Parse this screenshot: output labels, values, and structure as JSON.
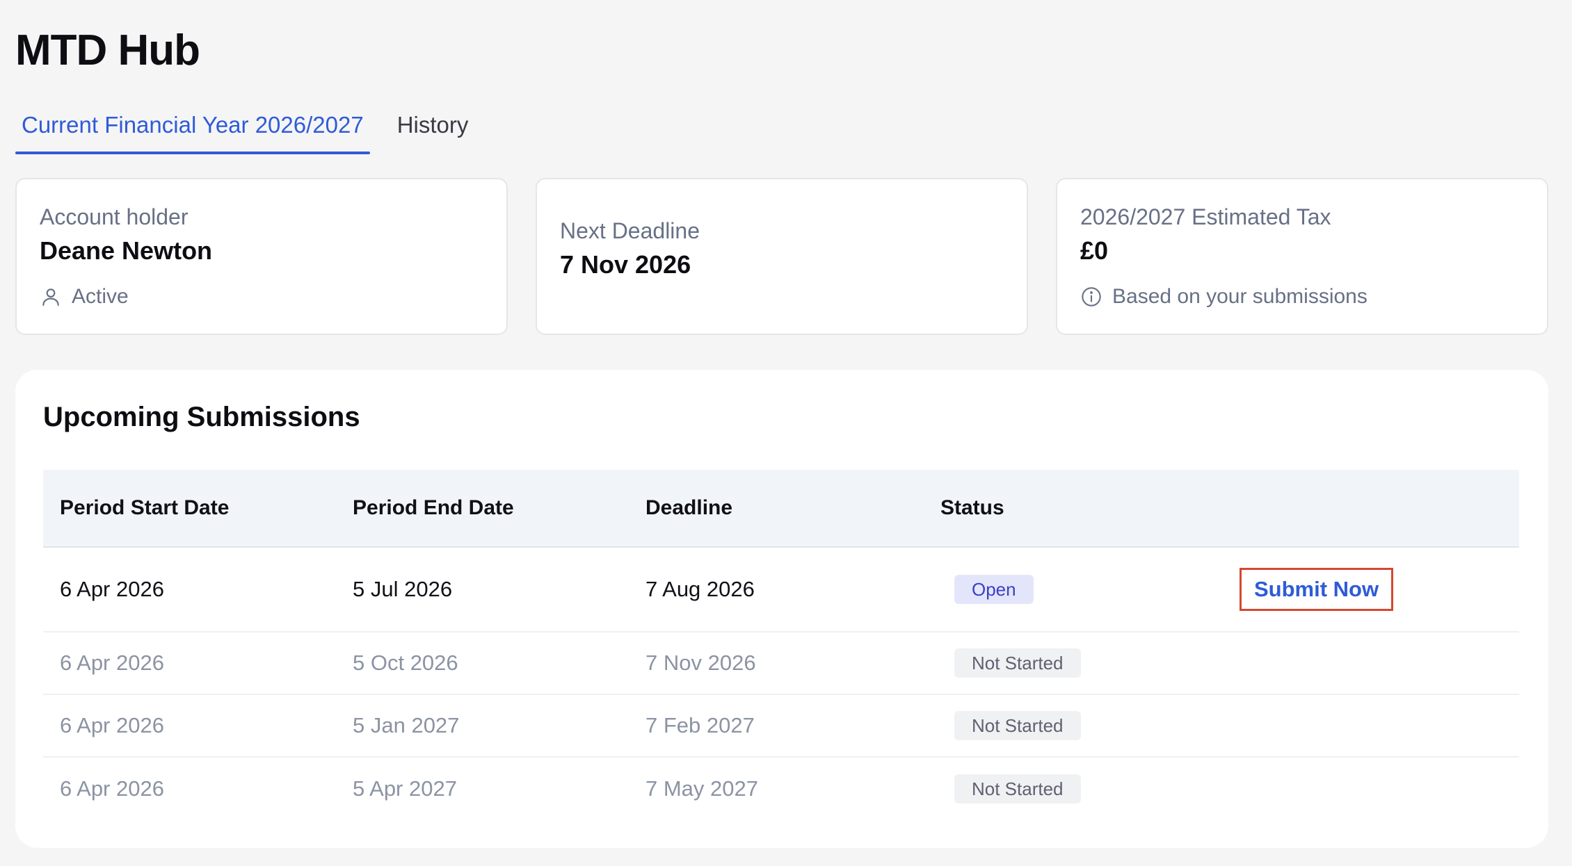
{
  "header": {
    "title": "MTD Hub"
  },
  "tabs": [
    {
      "label": "Current Financial Year 2026/2027",
      "active": true
    },
    {
      "label": "History",
      "active": false
    }
  ],
  "cards": {
    "account": {
      "label": "Account holder",
      "value": "Deane Newton",
      "meta": "Active",
      "icon": "user-icon"
    },
    "deadline": {
      "label": "Next Deadline",
      "value": "7 Nov 2026"
    },
    "tax": {
      "label": "2026/2027 Estimated Tax",
      "value": "£0",
      "meta": "Based on your submissions",
      "icon": "info-icon"
    }
  },
  "submissions": {
    "title": "Upcoming Submissions",
    "columns": [
      "Period Start Date",
      "Period End Date",
      "Deadline",
      "Status"
    ],
    "rows": [
      {
        "start": "6 Apr 2026",
        "end": "5 Jul 2026",
        "deadline": "7 Aug 2026",
        "status": "Open",
        "action": "Submit Now"
      },
      {
        "start": "6 Apr 2026",
        "end": "5 Oct 2026",
        "deadline": "7 Nov 2026",
        "status": "Not Started"
      },
      {
        "start": "6 Apr 2026",
        "end": "5 Jan 2027",
        "deadline": "7 Feb 2027",
        "status": "Not Started"
      },
      {
        "start": "6 Apr 2026",
        "end": "5 Apr 2027",
        "deadline": "7 May 2027",
        "status": "Not Started"
      }
    ]
  },
  "colors": {
    "accent": "#2f5bd6",
    "open_badge_bg": "#e3e6fb",
    "open_badge_text": "#3b3fc4",
    "highlight_border": "#d6472f",
    "muted_text": "#8b93a3"
  }
}
